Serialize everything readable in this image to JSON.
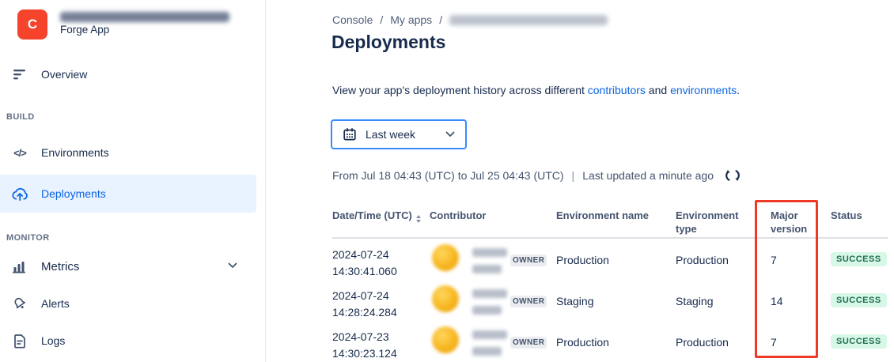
{
  "app": {
    "initial": "C",
    "type_label": "Forge App"
  },
  "sidebar": {
    "overview": "Overview",
    "build_section": "BUILD",
    "environments": "Environments",
    "deployments": "Deployments",
    "monitor_section": "MONITOR",
    "metrics": "Metrics",
    "alerts": "Alerts",
    "logs": "Logs"
  },
  "breadcrumb": {
    "console": "Console",
    "my_apps": "My apps",
    "separator": "/"
  },
  "page": {
    "title": "Deployments",
    "description_prefix": "View your app's deployment history across different ",
    "contributors_link": "contributors",
    "description_middle": " and ",
    "environments_link": "environments",
    "description_suffix": "."
  },
  "filter": {
    "selected_range": "Last week"
  },
  "status_bar": {
    "range_text": "From Jul 18 04:43 (UTC) to Jul 25 04:43 (UTC)",
    "separator": "|",
    "last_updated": "Last updated a minute ago"
  },
  "table": {
    "headers": {
      "datetime": "Date/Time (UTC)",
      "contributor": "Contributor",
      "env_name": "Environment name",
      "env_type": "Environment type",
      "major_version": "Major version",
      "status": "Status"
    },
    "rows": [
      {
        "date": "2024-07-24",
        "time": "14:30:41.060",
        "role": "OWNER",
        "env_name": "Production",
        "env_type": "Production",
        "major_version": "7",
        "status": "SUCCESS"
      },
      {
        "date": "2024-07-24",
        "time": "14:28:24.284",
        "role": "OWNER",
        "env_name": "Staging",
        "env_type": "Staging",
        "major_version": "14",
        "status": "SUCCESS"
      },
      {
        "date": "2024-07-23",
        "time": "14:30:23.124",
        "role": "OWNER",
        "env_name": "Production",
        "env_type": "Production",
        "major_version": "7",
        "status": "SUCCESS"
      }
    ]
  },
  "colors": {
    "accent_blue": "#0C66E4",
    "selected_item_bg": "#E9F2FF",
    "text_primary": "#172B4D",
    "text_secondary": "#44546F",
    "success_bg": "#D7F8E7",
    "success_text": "#216E4E",
    "annotation_red": "#EE3A24",
    "app_icon_red": "#F5442B",
    "filter_border_blue": "#388BFF"
  }
}
